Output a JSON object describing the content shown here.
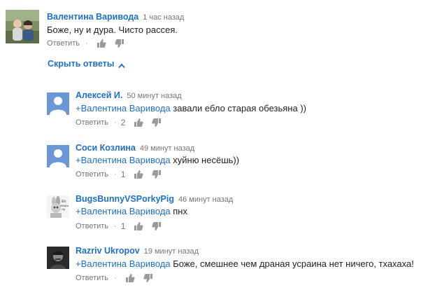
{
  "thread": {
    "toggle_replies_label": "Скрыть ответы",
    "reply_label": "Ответить",
    "dot": "·"
  },
  "comments": [
    {
      "author": "Валентина Варивода",
      "time": "1 час назад",
      "text": "Боже,  ну  и  дура. Чисто  рассея.",
      "mention": "",
      "likes": ""
    },
    {
      "author": "Алексей И.",
      "time": "50 минут назад",
      "mention": "+Валентина Варивода",
      "text": " завали ебло старая обезьяна ))",
      "likes": "2"
    },
    {
      "author": "Соси Козлина",
      "time": "49 минут назад",
      "mention": "+Валентина Варивода",
      "text": " хуйню несёшь))",
      "likes": "1"
    },
    {
      "author": "BugsBunnyVSPorkyPig",
      "time": "46 минут назад",
      "mention": "+Валентина Варивода",
      "text": " пнх",
      "likes": "1"
    },
    {
      "author": "Razriv Ukropov",
      "time": "19 минут назад",
      "mention": "+Валентина Варивода",
      "text": " Боже, смешнее чем драная усраина нет ничего, тхахаха!",
      "likes": ""
    }
  ],
  "colors": {
    "link": "#1f6fc5",
    "meta": "#767676",
    "default_avatar": "#6b97d6"
  },
  "icons": {
    "like": "thumbs-up-icon",
    "dislike": "thumbs-down-icon",
    "toggle": "chevron-up-icon"
  }
}
